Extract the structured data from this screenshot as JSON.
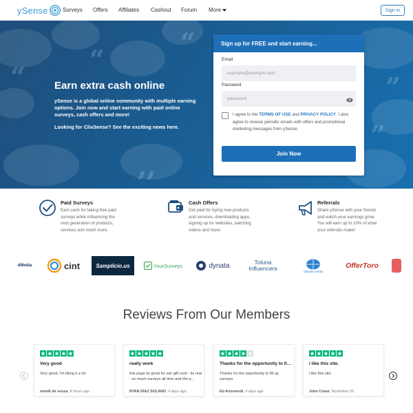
{
  "brand": {
    "logo_text": "ySense",
    "accent": "#1d6fb8",
    "logo_color": "#3a9bd6"
  },
  "nav": {
    "links": [
      "Surveys",
      "Offers",
      "Affiliates",
      "Cashout",
      "Forum",
      "More"
    ],
    "signin_label": "Sign in"
  },
  "hero": {
    "title": "Earn extra cash online",
    "description": "ySense is a global online community with multiple earning options. Join now and start earning with paid online surveys, cash offers and more!",
    "news": "Looking for ClixSense? See the exciting news here."
  },
  "signup": {
    "heading": "Sign up for FREE and start earning...",
    "email_label": "Email",
    "email_placeholder": "example@example.com",
    "password_label": "Password",
    "password_placeholder": "password",
    "agree_prefix": "I agree to the ",
    "terms_link": "TERMS OF USE",
    "and": " and ",
    "privacy_link": "PRIVACY POLICY",
    "agree_suffix": ". I also agree to receive periodic emails with offers and promotional marketing messages from ySense.",
    "join_label": "Join Now"
  },
  "features": [
    {
      "icon": "check-circle-icon",
      "title": "Paid Surveys",
      "text": "Earn cash for taking free paid surveys while influencing the next generation of products, services and much more."
    },
    {
      "icon": "cash-offers-icon",
      "title": "Cash Offers",
      "text": "Get paid for trying new products and services, downloading apps, signing up for websites, watching videos and more."
    },
    {
      "icon": "megaphone-icon",
      "title": "Referrals",
      "text": "Share ySense with your friends and watch your earnings grow. You will earn up to 10% of what your referrals make!"
    }
  ],
  "partners": [
    "dMedia",
    "cint",
    "Samplicio.us",
    "YourSurveys",
    "dynata",
    "Toluna Influencers",
    "AdGate media",
    "OfferToro"
  ],
  "reviews": {
    "title": "Reviews From Our Members",
    "items": [
      {
        "stars": 5,
        "heading": "Very good",
        "body": "Very good, I'm liking it a lot",
        "author": "monik de souza",
        "date": ", 8 hours ago"
      },
      {
        "stars": 5,
        "heading": "really work",
        "body": "this page its great for win gift card - its real - so much surveys all time and the p...",
        "author": "RYAN DIAZ SOLANO",
        "date": ", 4 days ago"
      },
      {
        "stars": 4,
        "heading": "Thanks for the opportunity to fill up surveys.",
        "body": "Thanks for the opportunity to fill up surveys.",
        "author": "Ed Arizmendi",
        "date": ", 4 days ago"
      },
      {
        "stars": 5,
        "heading": "i like this site.",
        "body": "i like this site.",
        "author": "John Crane",
        "date": ", November 20"
      }
    ]
  }
}
